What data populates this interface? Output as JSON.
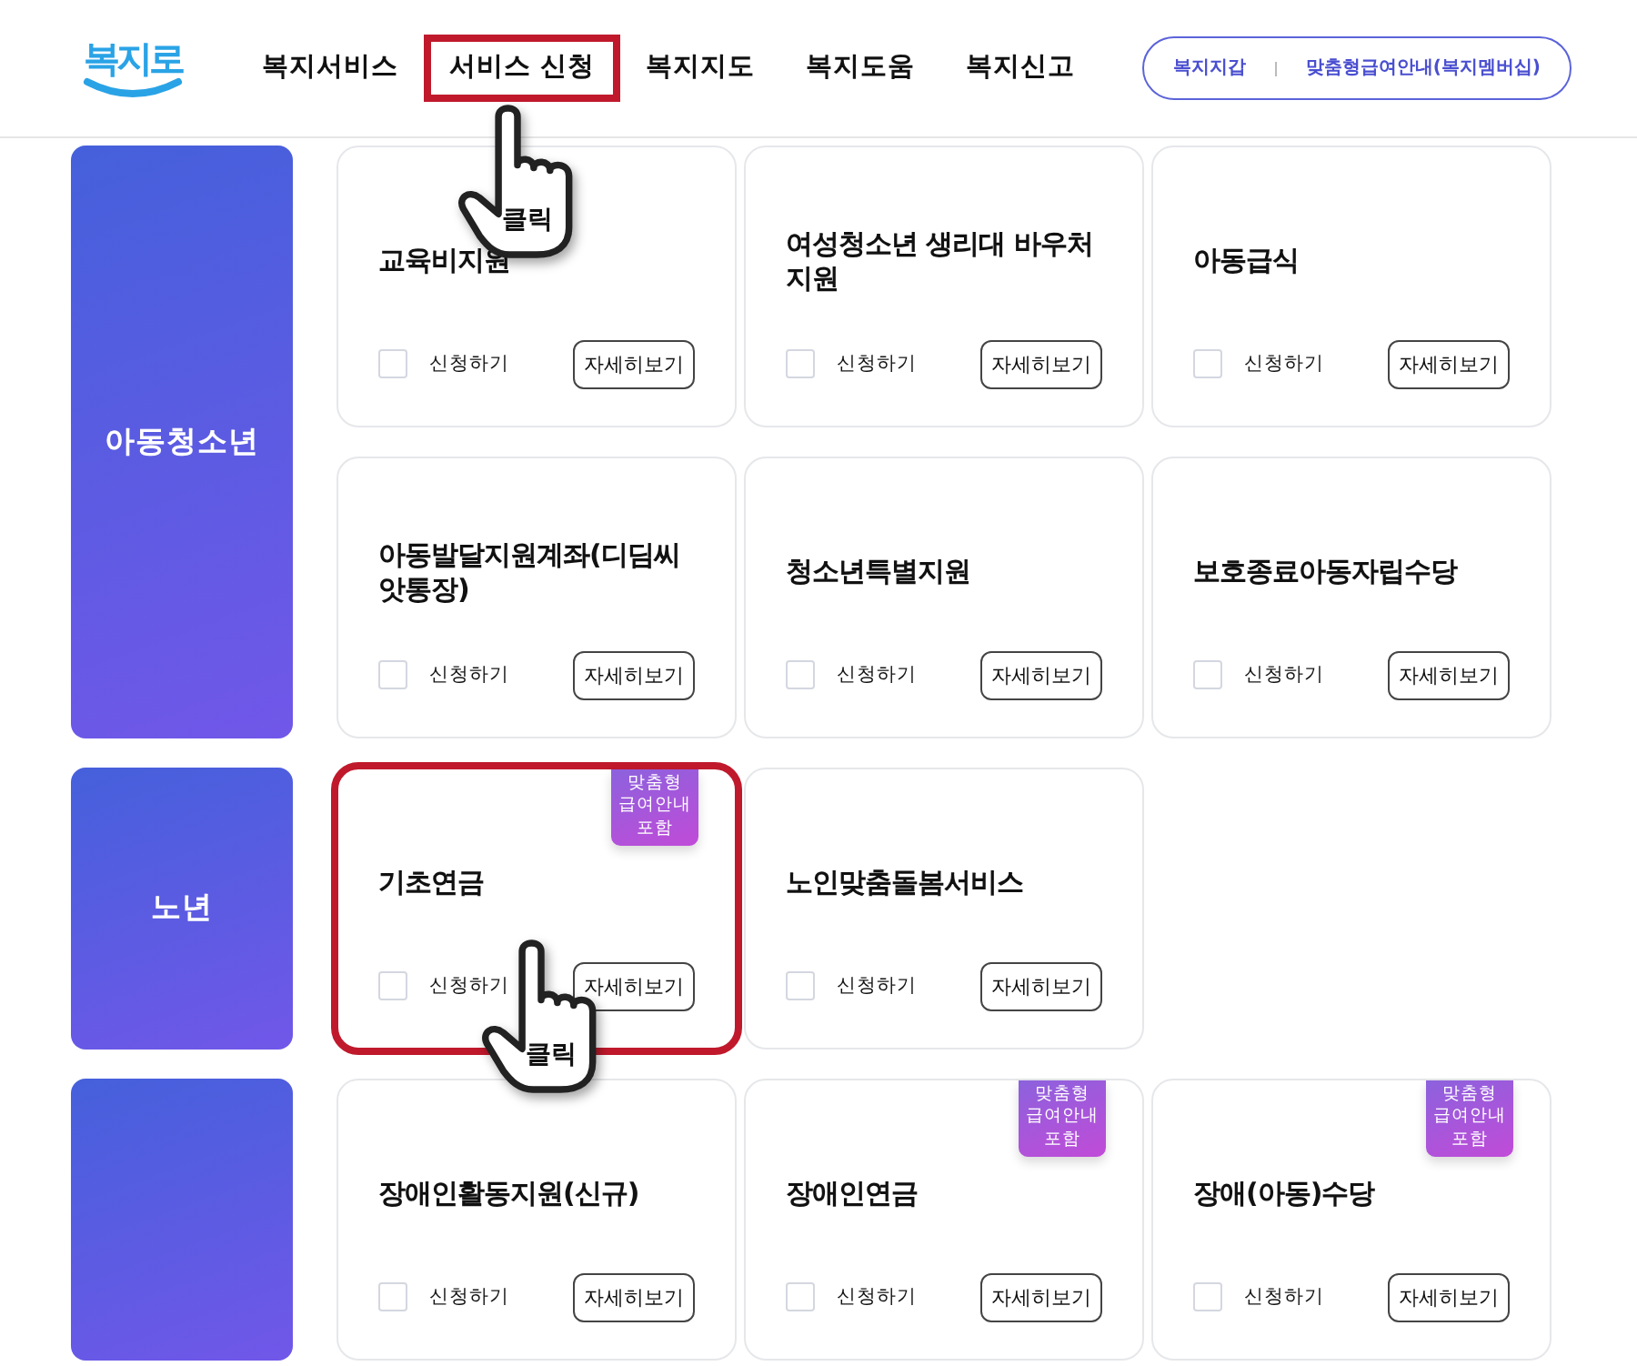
{
  "header": {
    "logo": "복지로",
    "nav": [
      {
        "label": "복지서비스",
        "highlighted": false
      },
      {
        "label": "서비스 신청",
        "highlighted": true,
        "callout": "클릭"
      },
      {
        "label": "복지지도",
        "highlighted": false
      },
      {
        "label": "복지도움",
        "highlighted": false
      },
      {
        "label": "복지신고",
        "highlighted": false
      }
    ],
    "quick_links": [
      "복지지갑",
      "맞춤형급여안내(복지멤버십)"
    ]
  },
  "sections": [
    {
      "category": "아동청소년",
      "services": [
        {
          "title": "교육비지원",
          "apply_label": "신청하기",
          "checked": false,
          "detail_button": "자세히보기",
          "highlighted": false
        },
        {
          "title": "여성청소년 생리대 바우처지원",
          "apply_label": "신청하기",
          "checked": false,
          "detail_button": "자세히보기",
          "highlighted": false
        },
        {
          "title": "아동급식",
          "apply_label": "신청하기",
          "checked": false,
          "detail_button": "자세히보기",
          "highlighted": false
        },
        {
          "title": "아동발달지원계좌(디딤씨앗통장)",
          "apply_label": "신청하기",
          "checked": false,
          "detail_button": "자세히보기",
          "highlighted": false
        },
        {
          "title": "청소년특별지원",
          "apply_label": "신청하기",
          "checked": false,
          "detail_button": "자세히보기",
          "highlighted": false
        },
        {
          "title": "보호종료아동자립수당",
          "apply_label": "신청하기",
          "checked": false,
          "detail_button": "자세히보기",
          "highlighted": false
        }
      ]
    },
    {
      "category": "노년",
      "services": [
        {
          "title": "기초연금",
          "badge": [
            "맞춤형",
            "급여안내",
            "포함"
          ],
          "apply_label": "신청하기",
          "checked": false,
          "detail_button": "자세히보기",
          "highlighted": true,
          "callout": "클릭"
        },
        {
          "title": "노인맞춤돌봄서비스",
          "apply_label": "신청하기",
          "checked": false,
          "detail_button": "자세히보기",
          "highlighted": false
        }
      ]
    },
    {
      "services": [
        {
          "title": "장애인활동지원(신규)",
          "apply_label": "신청하기",
          "checked": false,
          "detail_button": "자세히보기",
          "highlighted": false
        },
        {
          "title": "장애인연금",
          "badge": [
            "맞춤형",
            "급여안내",
            "포함"
          ],
          "apply_label": "신청하기",
          "checked": false,
          "detail_button": "자세히보기",
          "highlighted": false
        },
        {
          "title": "장애(아동)수당",
          "badge": [
            "맞춤형",
            "급여안내",
            "포함"
          ],
          "apply_label": "신청하기",
          "checked": false,
          "detail_button": "자세히보기",
          "highlighted": false
        }
      ]
    }
  ]
}
